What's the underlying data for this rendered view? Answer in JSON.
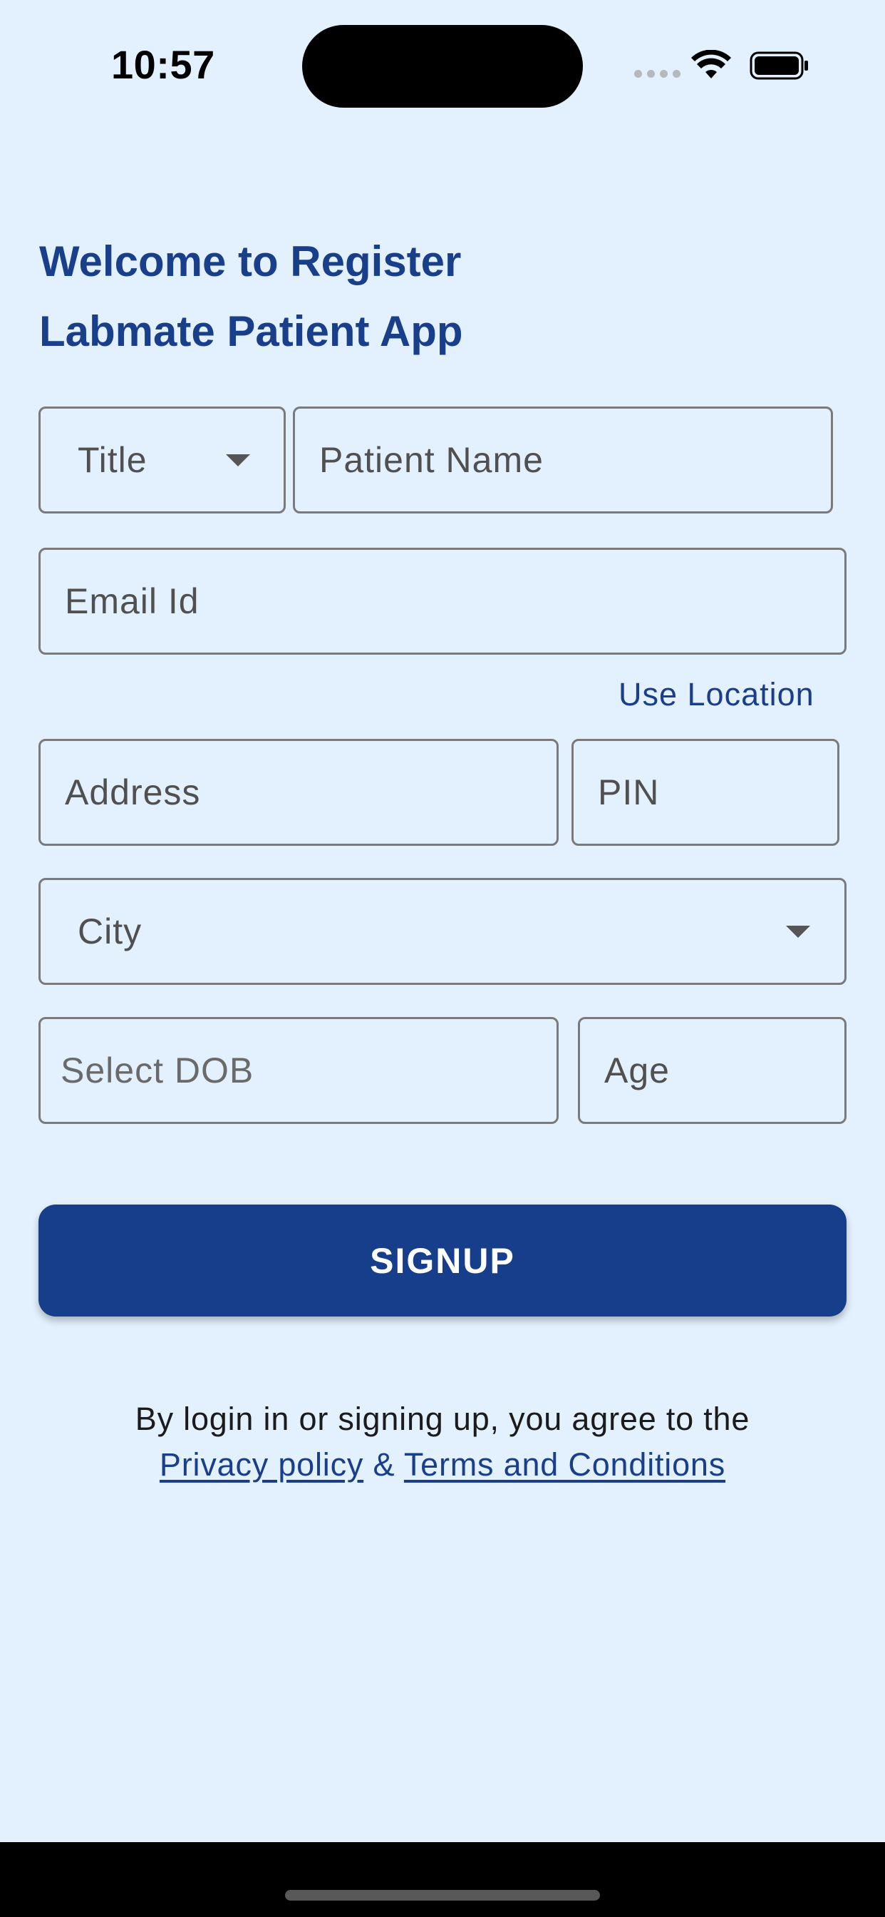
{
  "status_bar": {
    "time": "10:57"
  },
  "heading": {
    "line1": "Welcome to Register",
    "line2": "Labmate Patient App"
  },
  "form": {
    "title_select": {
      "value": "Title"
    },
    "patient_name": {
      "placeholder": "Patient Name"
    },
    "email": {
      "placeholder": "Email Id"
    },
    "use_location": "Use Location",
    "address": {
      "placeholder": "Address"
    },
    "pin": {
      "placeholder": "PIN"
    },
    "city_select": {
      "value": "City"
    },
    "dob": {
      "placeholder": "Select DOB"
    },
    "age": {
      "placeholder": "Age"
    }
  },
  "signup_button": "SIGNUP",
  "terms": {
    "prefix": "By login in or signing up, you agree to the",
    "privacy_link": "Privacy policy",
    "separator": "&",
    "terms_link": "Terms and Conditions"
  },
  "colors": {
    "background": "#e3f0fd",
    "accent": "#1a3f8a",
    "button": "#173e8a",
    "field_border": "#7a7a7a"
  }
}
